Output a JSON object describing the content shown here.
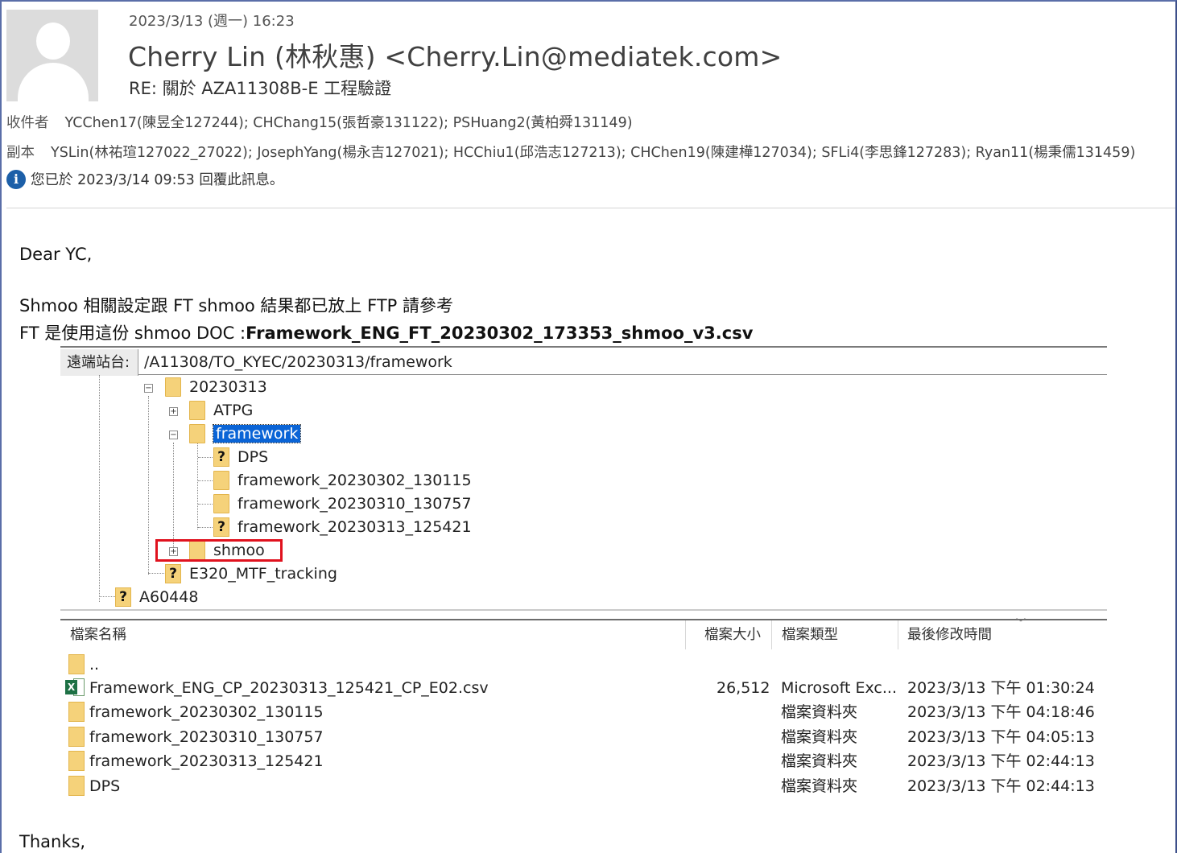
{
  "email": {
    "date": "2023/3/13 (週一) 16:23",
    "from": "Cherry Lin (林秋惠) <Cherry.Lin@mediatek.com>",
    "subject": "RE: 關於 AZA11308B-E 工程驗證",
    "to_label": "收件者",
    "to": "YCChen17(陳昱全127244); CHChang15(張哲豪131122); PSHuang2(黃柏舜131149)",
    "cc_label": "副本",
    "cc": "YSLin(林祐瑄127022_27022); JosephYang(楊永吉127021); HCChiu1(邱浩志127213); CHChen19(陳建樺127034); SFLi4(李思鋒127283); Ryan11(楊秉儒131459)",
    "info": "您已於 2023/3/14 09:53 回覆此訊息。",
    "info_icon": "info-icon"
  },
  "body": {
    "greeting": "Dear YC,",
    "line1": "Shmoo 相關設定跟 FT shmoo 結果都已放上 FTP 請參考",
    "line2_prefix": "FT 是使用這份  shmoo DOC :",
    "line2_file": "Framework_ENG_FT_20230302_173353_shmoo_v3.csv",
    "closing": "Thanks,"
  },
  "ftp": {
    "remote_label": "遠端站台:",
    "remote_path": "/A11308/TO_KYEC/20230313/framework",
    "tree": [
      {
        "label": "20230313",
        "toggle": "⊟"
      },
      {
        "label": "ATPG",
        "toggle": "⊞"
      },
      {
        "label": "framework",
        "toggle": "⊟",
        "selected": true
      },
      {
        "label": "DPS",
        "question": true
      },
      {
        "label": "framework_20230302_130115"
      },
      {
        "label": "framework_20230310_130757"
      },
      {
        "label": "framework_20230313_125421",
        "question": true
      },
      {
        "label": "shmoo",
        "toggle": "⊞",
        "highlight_color": "#e0121e"
      },
      {
        "label": "E320_MTF_tracking",
        "question": true
      },
      {
        "label": "A60448",
        "question": true
      }
    ],
    "columns": {
      "name": "檔案名稱",
      "size": "檔案大小",
      "type": "檔案類型",
      "modified": "最後修改時間"
    },
    "files": [
      {
        "name": "..",
        "size": "",
        "type": "",
        "modified": "",
        "icon": "folder-icon"
      },
      {
        "name": "Framework_ENG_CP_20230313_125421_CP_E02.csv",
        "size": "26,512",
        "type": "Microsoft Exc...",
        "modified": "2023/3/13 下午 01:30:24",
        "icon": "excel-icon"
      },
      {
        "name": "framework_20230302_130115",
        "size": "",
        "type": "檔案資料夾",
        "modified": "2023/3/13 下午 04:18:46",
        "icon": "folder-icon"
      },
      {
        "name": "framework_20230310_130757",
        "size": "",
        "type": "檔案資料夾",
        "modified": "2023/3/13 下午 04:05:13",
        "icon": "folder-icon"
      },
      {
        "name": "framework_20230313_125421",
        "size": "",
        "type": "檔案資料夾",
        "modified": "2023/3/13 下午 02:44:13",
        "icon": "folder-icon"
      },
      {
        "name": "DPS",
        "size": "",
        "type": "檔案資料夾",
        "modified": "2023/3/13 下午 02:44:13",
        "icon": "folder-icon"
      }
    ]
  }
}
